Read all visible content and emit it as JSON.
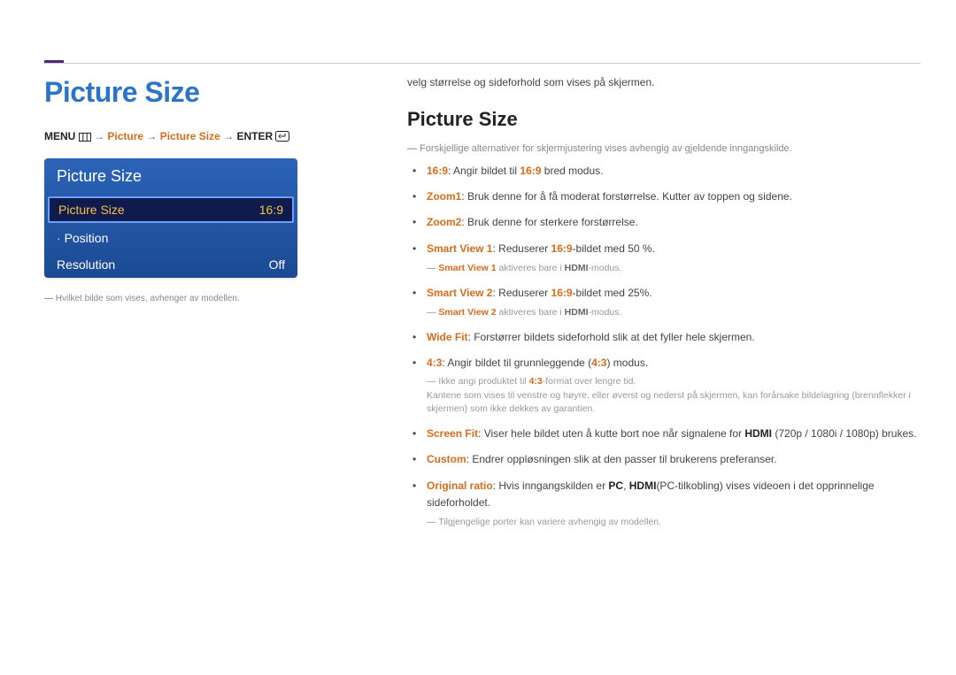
{
  "header": {
    "page_title": "Picture Size"
  },
  "breadcrumb": {
    "menu_label": "MENU",
    "arrow": "→",
    "p1": "Picture",
    "p2": "Picture Size",
    "enter_label": "ENTER"
  },
  "osd": {
    "title": "Picture Size",
    "rows": [
      {
        "label": "Picture Size",
        "value": "16:9",
        "selected": true
      },
      {
        "label": "Position",
        "value": "",
        "indent": true
      },
      {
        "label": "Resolution",
        "value": "Off"
      }
    ]
  },
  "left_footnote": "Hvilket bilde som vises, avhenger av modellen.",
  "right": {
    "lead": "velg størrelse og sideforhold som vises på skjermen.",
    "sub_title": "Picture Size",
    "pre_note": "Forskjellige alternativer for skjermjustering vises avhengig av gjeldende inngangskilde.",
    "items": {
      "i169": {
        "kw": "16:9",
        "txt1": ": Angir bildet til ",
        "kw2": "16:9",
        "txt2": " bred modus."
      },
      "zoom1": {
        "kw": "Zoom1",
        "txt": ": Bruk denne for å få moderat forstørrelse. Kutter av toppen og sidene."
      },
      "zoom2": {
        "kw": "Zoom2",
        "txt": ": Bruk denne for sterkere forstørrelse."
      },
      "sv1": {
        "kw": "Smart View 1",
        "txt1": ": Reduserer ",
        "kw2": "16:9",
        "txt2": "-bildet med 50 %."
      },
      "sv1_note": {
        "kw": "Smart View 1",
        "txt1": " aktiveres bare i ",
        "kwb": "HDMI",
        "txt2": "-modus."
      },
      "sv2": {
        "kw": "Smart View 2",
        "txt1": ": Reduserer ",
        "kw2": "16:9",
        "txt2": "-bildet med 25%."
      },
      "sv2_note": {
        "kw": "Smart View 2",
        "txt1": " aktiveres bare i ",
        "kwb": "HDMI",
        "txt2": "-modus."
      },
      "widefit": {
        "kw": "Wide Fit",
        "txt": ": Forstørrer bildets sideforhold slik at det fyller hele skjermen."
      },
      "r43": {
        "kw": "4:3",
        "txt1": ": Angir bildet til grunnleggende (",
        "kw2": "4:3",
        "txt2": ") modus."
      },
      "r43_note1": {
        "txt1": "Ikke angi produktet til ",
        "kw": "4:3",
        "txt2": "-format over lengre tid."
      },
      "r43_note2": "Kantene som vises til venstre og høyre, eller øverst og nederst på skjermen, kan forårsake bildelagring (brennflekker i skjermen) som ikke dekkes av garantien.",
      "screenfit": {
        "kw": "Screen Fit",
        "txt1": ": Viser hele bildet uten å kutte bort noe når signalene for ",
        "kwb": "HDMI",
        "txt2": " (720p / 1080i / 1080p) brukes."
      },
      "custom": {
        "kw": "Custom",
        "txt": ": Endrer oppløsningen slik at den passer til brukerens preferanser."
      },
      "orig": {
        "kw": "Original ratio",
        "txt1": ": Hvis inngangskilden er ",
        "kwb1": "PC",
        "comma": ", ",
        "kwb2": "HDMI",
        "txt2": "(PC-tilkobling) vises videoen i det opprinnelige sideforholdet."
      },
      "orig_note": "Tilgjengelige porter kan variere avhengig av modellen."
    }
  }
}
